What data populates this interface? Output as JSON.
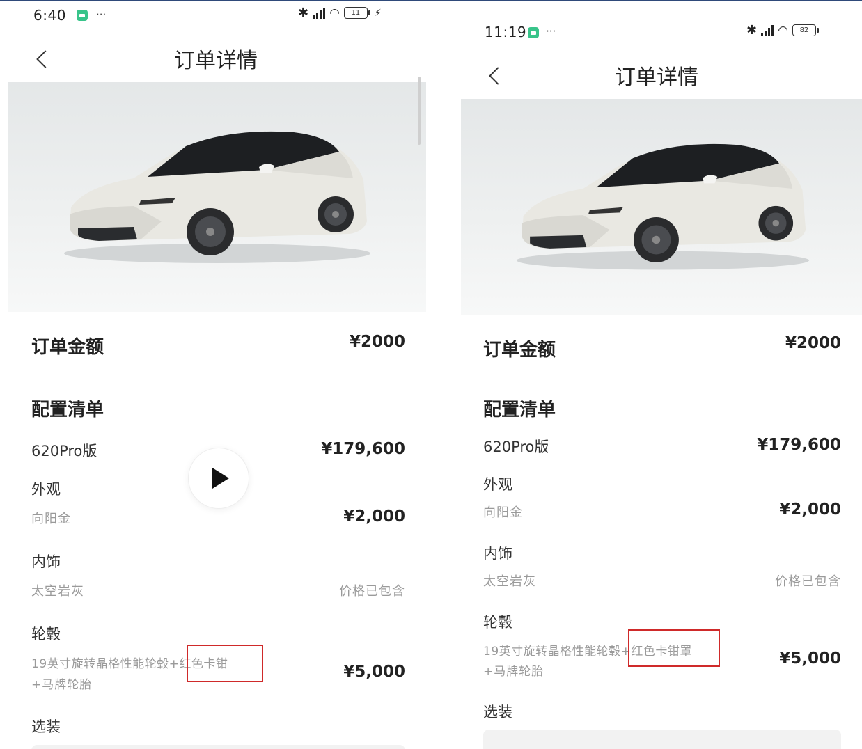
{
  "left": {
    "status": {
      "time": "6:40",
      "dots": "···",
      "network": "HD",
      "battery": "11",
      "extra": "⚡"
    },
    "title": "订单详情",
    "order_amount": {
      "label": "订单金额",
      "value": "¥2000"
    },
    "config_title": "配置清单",
    "version": {
      "label": "620Pro版",
      "price": "¥179,600"
    },
    "exterior": {
      "label": "外观",
      "value": "向阳金",
      "price": "¥2,000"
    },
    "interior": {
      "label": "内饰",
      "value": "太空岩灰",
      "price": "价格已包含"
    },
    "wheels": {
      "label": "轮毂",
      "line1_pre": "19英寸旋转晶格性能轮毂+",
      "line1_hl": "红色卡钳",
      "line2": "+马牌轮胎",
      "price": "¥5,000"
    },
    "options_title": "选装"
  },
  "right": {
    "status": {
      "time": "11:19",
      "dots": "···",
      "network": "HD",
      "battery": "82"
    },
    "title": "订单详情",
    "order_amount": {
      "label": "订单金额",
      "value": "¥2000"
    },
    "config_title": "配置清单",
    "version": {
      "label": "620Pro版",
      "price": "¥179,600"
    },
    "exterior": {
      "label": "外观",
      "value": "向阳金",
      "price": "¥2,000"
    },
    "interior": {
      "label": "内饰",
      "value": "太空岩灰",
      "price": "价格已包含"
    },
    "wheels": {
      "label": "轮毂",
      "line1_pre": "19英寸旋转晶格性能轮毂+",
      "line1_hl": "红色卡钳罩",
      "line2": "+马牌轮胎",
      "price": "¥5,000"
    },
    "options_title": "选装"
  },
  "colors": {
    "highlight": "#cf2a2a",
    "car_body": "#e9e8e2",
    "status_badge": "#38c48a"
  }
}
